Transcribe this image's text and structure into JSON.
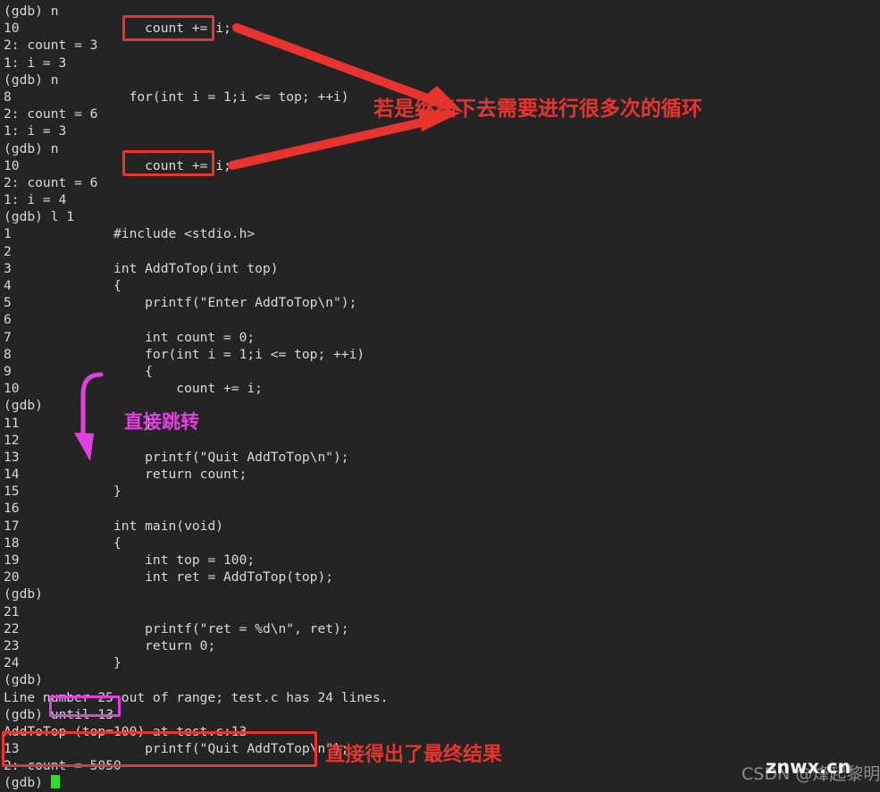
{
  "terminal": {
    "background": "#242424",
    "foreground": "#d9d9d9",
    "cursor_color": "#29e329",
    "prompt": "(gdb)",
    "lines": [
      "(gdb) n",
      "10\t          count += i;",
      "2: count = 3",
      "1: i = 3",
      "(gdb) n",
      "8\t        for(int i = 1;i <= top; ++i)",
      "2: count = 6",
      "1: i = 3",
      "(gdb) n",
      "10\t          count += i;",
      "2: count = 6",
      "1: i = 4",
      "(gdb) l 1",
      "1\t      #include <stdio.h>",
      "2\t",
      "3\t      int AddToTop(int top)",
      "4\t      {",
      "5\t          printf(\"Enter AddToTop\\n\");",
      "6\t",
      "7\t          int count = 0;",
      "8\t          for(int i = 1;i <= top; ++i)",
      "9\t          {",
      "10\t              count += i;",
      "(gdb)",
      "11\t          }",
      "12\t",
      "13\t          printf(\"Quit AddToTop\\n\");",
      "14\t          return count;",
      "15\t      }",
      "16\t",
      "17\t      int main(void)",
      "18\t      {",
      "19\t          int top = 100;",
      "20\t          int ret = AddToTop(top);",
      "(gdb)",
      "21\t",
      "22\t          printf(\"ret = %d\\n\", ret);",
      "23\t          return 0;",
      "24\t      }",
      "(gdb)",
      "Line number 25 out of range; test.c has 24 lines.",
      "(gdb) until 13",
      "AddToTop (top=100) at test.c:13",
      "13\t          printf(\"Quit AddToTop\\n\");",
      "2: count = 5050",
      "(gdb) "
    ],
    "rendered_lines": [
      {
        "num": "",
        "text": "(gdb) n"
      },
      {
        "num": "10",
        "text": "          count += i;"
      },
      {
        "num": "",
        "text": "2: count = 3"
      },
      {
        "num": "",
        "text": "1: i = 3"
      },
      {
        "num": "",
        "text": "(gdb) n"
      },
      {
        "num": "8",
        "text": "        for(int i = 1;i <= top; ++i)"
      },
      {
        "num": "",
        "text": "2: count = 6"
      },
      {
        "num": "",
        "text": "1: i = 3"
      },
      {
        "num": "",
        "text": "(gdb) n"
      },
      {
        "num": "10",
        "text": "          count += i;"
      },
      {
        "num": "",
        "text": "2: count = 6"
      },
      {
        "num": "",
        "text": "1: i = 4"
      },
      {
        "num": "",
        "text": "(gdb) l 1"
      },
      {
        "num": "1",
        "text": "      #include <stdio.h>"
      },
      {
        "num": "2",
        "text": ""
      },
      {
        "num": "3",
        "text": "      int AddToTop(int top)"
      },
      {
        "num": "4",
        "text": "      {"
      },
      {
        "num": "5",
        "text": "          printf(\"Enter AddToTop\\n\");"
      },
      {
        "num": "6",
        "text": ""
      },
      {
        "num": "7",
        "text": "          int count = 0;"
      },
      {
        "num": "8",
        "text": "          for(int i = 1;i <= top; ++i)"
      },
      {
        "num": "9",
        "text": "          {"
      },
      {
        "num": "10",
        "text": "              count += i;"
      },
      {
        "num": "",
        "text": "(gdb)"
      },
      {
        "num": "11",
        "text": "          }"
      },
      {
        "num": "12",
        "text": ""
      },
      {
        "num": "13",
        "text": "          printf(\"Quit AddToTop\\n\");"
      },
      {
        "num": "14",
        "text": "          return count;"
      },
      {
        "num": "15",
        "text": "      }"
      },
      {
        "num": "16",
        "text": ""
      },
      {
        "num": "17",
        "text": "      int main(void)"
      },
      {
        "num": "18",
        "text": "      {"
      },
      {
        "num": "19",
        "text": "          int top = 100;"
      },
      {
        "num": "20",
        "text": "          int ret = AddToTop(top);"
      },
      {
        "num": "",
        "text": "(gdb)"
      },
      {
        "num": "21",
        "text": ""
      },
      {
        "num": "22",
        "text": "          printf(\"ret = %d\\n\", ret);"
      },
      {
        "num": "23",
        "text": "          return 0;"
      },
      {
        "num": "24",
        "text": "      }"
      },
      {
        "num": "",
        "text": "(gdb)"
      },
      {
        "num": "",
        "text": "Line number 25 out of range; test.c has 24 lines."
      },
      {
        "num": "",
        "text": "(gdb) until 13"
      },
      {
        "num": "",
        "text": "AddToTop (top=100) at test.c:13"
      },
      {
        "num": "13",
        "text": "          printf(\"Quit AddToTop\\n\");"
      },
      {
        "num": "",
        "text": "2: count = 5050"
      },
      {
        "num": "",
        "text": "(gdb) "
      }
    ]
  },
  "annotations": {
    "red_color": "#e8332e",
    "magenta_color": "#e33fe3",
    "note_loop": "若是继续下去需要进行很多次的循环",
    "note_jump": "直接跳转",
    "note_result": "直接得出了最终结果",
    "highlight_1": "count += i;",
    "highlight_2": "count += i;",
    "highlight_until": "until 13",
    "highlight_result_line": "13          printf(\"Quit AddToTop\\n\");",
    "highlight_result_value": "2: count = 5050"
  },
  "watermark": {
    "csdn": "CSDN @烽起黎明",
    "site": "znwx.cn"
  }
}
